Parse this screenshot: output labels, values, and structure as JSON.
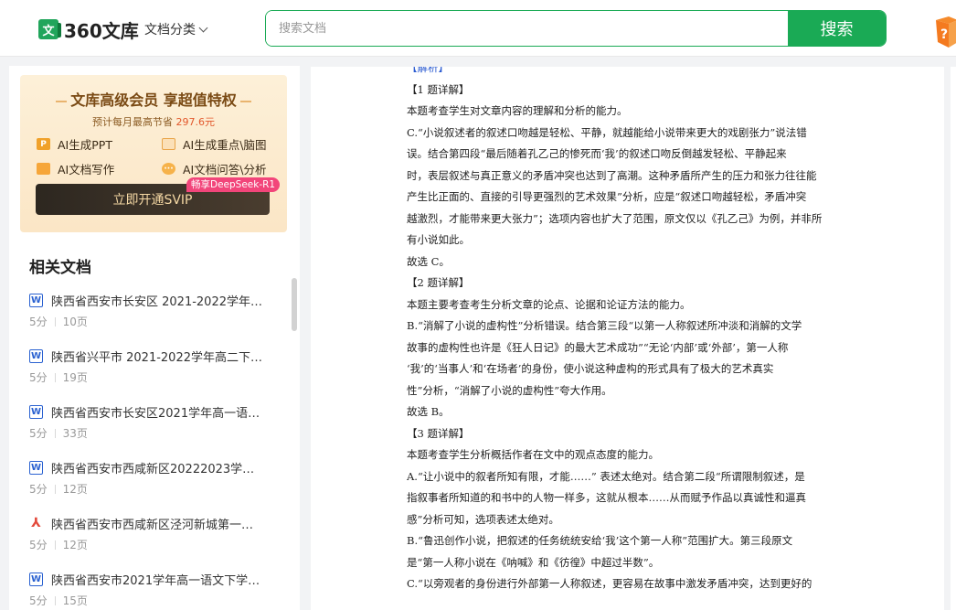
{
  "header": {
    "logo_text": "360文库",
    "category_label": "文档分类",
    "search_placeholder": "搜索文档",
    "search_button": "搜索"
  },
  "vip": {
    "title": "文库高级会员 享超值特权",
    "subtitle_prefix": "预计每月最高节省",
    "subtitle_price": "297.6元",
    "features": [
      {
        "icon": "P",
        "label": "AI生成PPT"
      },
      {
        "icon": "mind-map-icon",
        "label": "AI生成重点\\脑图"
      },
      {
        "icon": "write-icon",
        "label": "AI文档写作"
      },
      {
        "icon": "chat-icon",
        "label": "AI文档问答\\分析"
      }
    ],
    "button_label": "立即开通SVIP",
    "tag": "畅享DeepSeek-R1"
  },
  "related": {
    "title": "相关文档",
    "items": [
      {
        "type": "W",
        "name": "陕西省西安市长安区 2021-2022学年…",
        "score": "5分",
        "pages": "10页"
      },
      {
        "type": "W",
        "name": "陕西省兴平市 2021-2022学年高二下…",
        "score": "5分",
        "pages": "19页"
      },
      {
        "type": "W",
        "name": "陕西省西安市长安区2021学年高一语…",
        "score": "5分",
        "pages": "33页"
      },
      {
        "type": "W",
        "name": "陕西省西安市西咸新区20222023学…",
        "score": "5分",
        "pages": "12页"
      },
      {
        "type": "PDF",
        "name": "陕西省西安市西咸新区泾河新城第一…",
        "score": "5分",
        "pages": "12页"
      },
      {
        "type": "W",
        "name": "陕西省西安市2021学年高一语文下学…",
        "score": "5分",
        "pages": "15页"
      }
    ]
  },
  "document": {
    "lines": [
      "【解析】",
      "【1 题详解】",
      "本题考查学生对文章内容的理解和分析的能力。",
      "C.“小说叙述者的叙述口吻越是轻松、平静，就越能给小说带来更大的戏剧张力”说法错",
      "误。结合第四段“最后随着孔乙己的惨死而‘我’的叙述口吻反倒越发轻松、平静起来",
      "时，表层叙述与真正意义的矛盾冲突也达到了高潮。这种矛盾所产生的压力和张力往往能",
      "产生比正面的、直接的引导更强烈的艺术效果”分析，应是“叙述口吻越轻松，矛盾冲突",
      "越激烈，才能带来更大张力”；选项内容也扩大了范围，原文仅以《孔乙己》为例，并非所",
      "有小说如此。",
      "故选 C。",
      "【2 题详解】",
      "本题主要考查考生分析文章的论点、论据和论证方法的能力。",
      "B.“消解了小说的虚构性”分析错误。结合第三段“以第一人称叙述所冲淡和消解的文学",
      "故事的虚构性也许是《狂人日记》的最大艺术成功”“无论‘内部’或‘外部’，第一人称",
      "‘我’的‘当事人’和‘在场者’的身份，使小说这种虚构的形式具有了极大的艺术真实",
      "性”分析，“消解了小说的虚构性”夸大作用。",
      "故选 B。",
      "【3 题详解】",
      "本题考查学生分析概括作者在文中的观点态度的能力。",
      "A.“让小说中的叙者所知有限，才能……” 表述太绝对。结合第二段“所谓限制叙述，是",
      "指叙事者所知道的和书中的人物一样多，这就从根本……从而赋予作品以真诚性和逼真",
      "感”分析可知，选项表述太绝对。",
      "B.“鲁迅创作小说，把叙述的任务统统安给‘我’这个第一人称”范围扩大。第三段原文",
      "是“第一人称小说在《呐喊》和《彷徨》中超过半数”。",
      "C.“以旁观者的身份进行外部第一人称叙述，更容易在故事中激发矛盾冲突，达到更好的"
    ]
  },
  "colors": {
    "brand_green": "#1aaa55",
    "price_red": "#e2572b",
    "tag_pink": "#f2457a",
    "word_blue": "#2b62d1",
    "pdf_red": "#e34a3c"
  }
}
